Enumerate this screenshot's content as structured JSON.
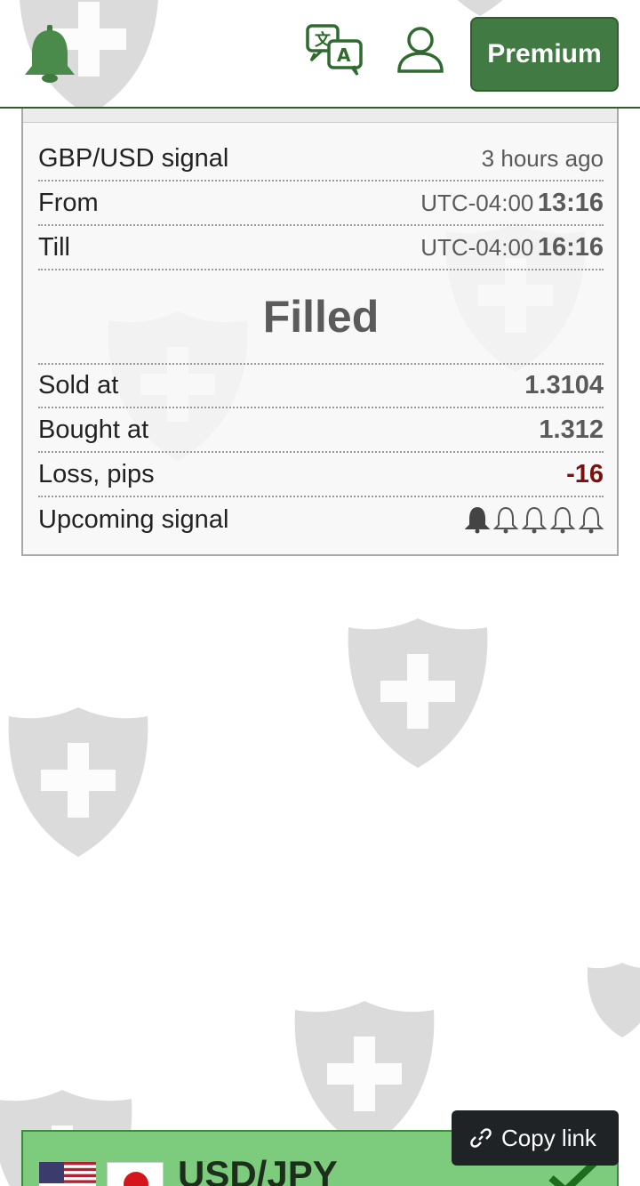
{
  "header": {
    "logo_icon": "bell-icon",
    "translate_icon": "translate-icon",
    "user_icon": "user-icon",
    "premium_label": "Premium",
    "accent_color": "#427a43"
  },
  "signal_card": {
    "title": "GBP/USD signal",
    "time_ago": "3 hours ago",
    "from_label": "From",
    "from_tz": "UTC-04:00",
    "from_time": "13:16",
    "till_label": "Till",
    "till_tz": "UTC-04:00",
    "till_time": "16:16",
    "status": "Filled",
    "sold_label": "Sold at",
    "sold_value": "1.3104",
    "bought_label": "Bought at",
    "bought_value": "1.312",
    "loss_label": "Loss, pips",
    "loss_value": "-16",
    "loss_color": "#7a1010",
    "upcoming_label": "Upcoming signal",
    "upcoming_level": 1,
    "upcoming_max": 5
  },
  "next_card": {
    "pair": "USD/JPY",
    "flag_left": "us-flag",
    "flag_right": "jp-flag",
    "status_icon": "check-icon",
    "bg_color": "#7dcc7d"
  },
  "toast": {
    "icon": "link-icon",
    "label": "Copy link"
  },
  "watermark_icon": "shield-cross-icon"
}
